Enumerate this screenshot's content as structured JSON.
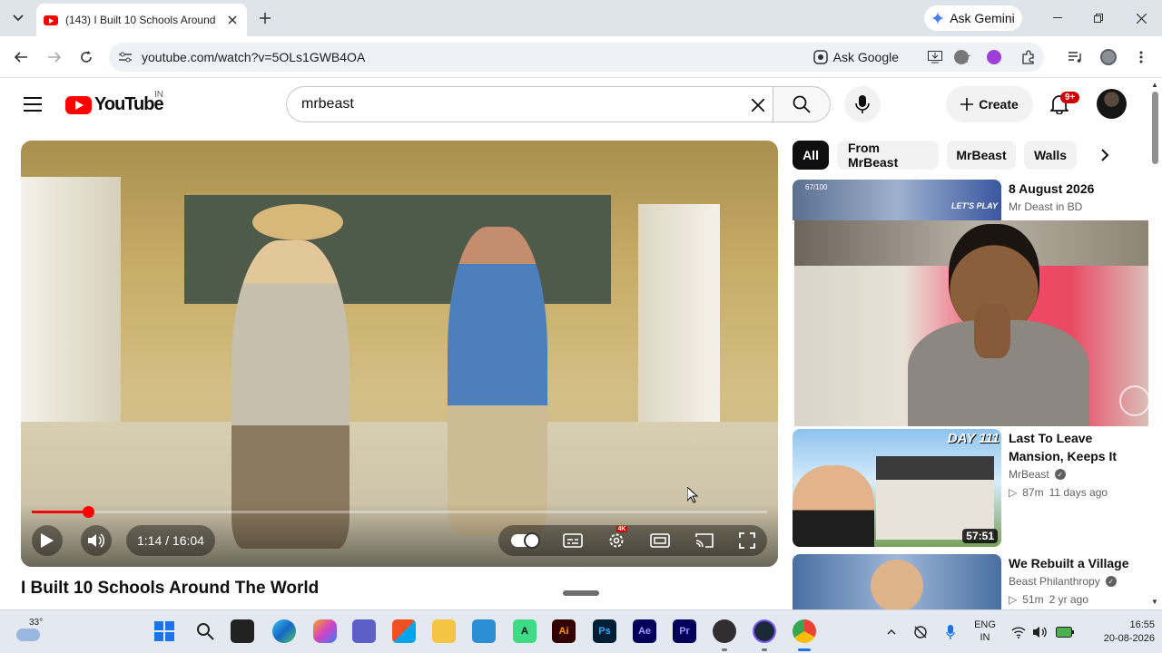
{
  "browser": {
    "tab_title": "(143) I Built 10 Schools Around",
    "ask_gemini": "Ask Gemini",
    "url": "youtube.com/watch?v=5OLs1GWB4OA",
    "ask_google": "Ask Google"
  },
  "youtube": {
    "logo_text": "YouTube",
    "country": "IN",
    "search_value": "mrbeast",
    "create_label": "Create",
    "notification_count": "9+"
  },
  "player": {
    "time": "1:14 / 16:04",
    "progress_fraction": 0.077,
    "video_title": "I Built 10 Schools Around The World",
    "hd_badge": "4K"
  },
  "chips": [
    "All",
    "From MrBeast",
    "MrBeast",
    "Walls"
  ],
  "sidebar": {
    "item0": {
      "thumb_text": "67/100",
      "title": "8 August 2026",
      "channel": "Mr Deast in BD",
      "thumb_badge": "LET'S PLAY"
    },
    "item1": {
      "title": "Last To Leave Mansion, Keeps It",
      "channel": "MrBeast",
      "views": "87m",
      "age": "11 days ago",
      "duration": "57:51",
      "thumb_badge": "DAY 111"
    },
    "item2": {
      "title": "We Rebuilt a Village",
      "channel": "Beast Philanthropy",
      "views": "51m",
      "age": "2 yr ago"
    }
  },
  "taskbar": {
    "weather": "33°",
    "lang_line1": "ENG",
    "lang_line2": "IN",
    "clock_time": "16:55",
    "clock_date": "20-08-2026",
    "apps": [
      "windows-start",
      "search",
      "file-explorer-dark",
      "edge",
      "copilot",
      "teams",
      "store",
      "folder",
      "vscode",
      "android-studio",
      "illustrator",
      "photoshop",
      "after-effects",
      "premiere",
      "obs",
      "steam",
      "chrome"
    ],
    "app_labels": {
      "illustrator": "Ai",
      "photoshop": "Ps",
      "after_effects": "Ae",
      "premiere": "Pr"
    }
  },
  "colors": {
    "yt_red": "#ff0000",
    "chrome_bg": "#dfe3ea"
  }
}
